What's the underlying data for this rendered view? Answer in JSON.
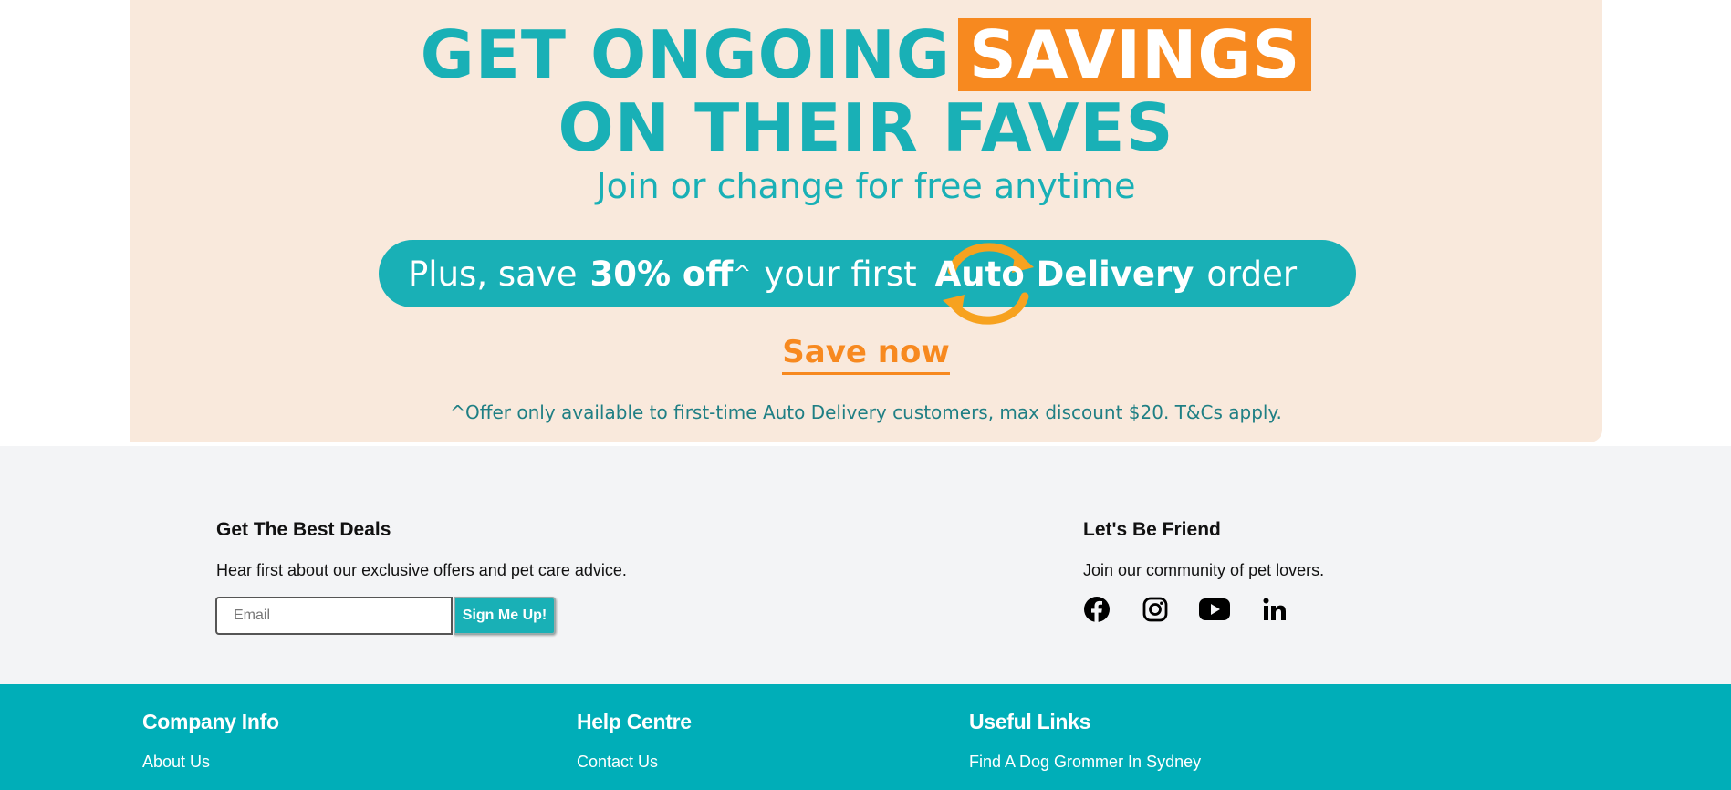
{
  "banner": {
    "headline_part1": "GET ONGOING",
    "headline_highlight": "SAVINGS",
    "headline_line2": "ON THEIR FAVES",
    "subheadline": "Join or change for free anytime",
    "pill": {
      "prefix": "Plus, save",
      "discount": "30% off",
      "caret": "^",
      "middle": "your first",
      "program": "Auto Delivery",
      "suffix": "order"
    },
    "cta": "Save now",
    "disclaimer": "^Offer only available to first-time Auto Delivery customers, max discount $20. T&Cs apply.",
    "colors": {
      "background": "#f9e9dc",
      "teal": "#19b0b6",
      "orange": "#f7891f"
    }
  },
  "newsletter": {
    "heading": "Get The Best Deals",
    "description": "Hear first about our exclusive offers and pet care advice.",
    "email_placeholder": "Email",
    "email_value": "",
    "button_label": "Sign Me Up!"
  },
  "social": {
    "heading": "Let's Be Friend",
    "description": "Join our community of pet lovers.",
    "icons": [
      "facebook-icon",
      "instagram-icon",
      "youtube-icon",
      "linkedin-icon"
    ]
  },
  "footer": {
    "background": "#00aeb8",
    "columns": [
      {
        "heading": "Company Info",
        "first_link": "About Us"
      },
      {
        "heading": "Help Centre",
        "first_link": "Contact Us"
      },
      {
        "heading": "Useful Links",
        "first_link": "Find A Dog Grommer In Sydney"
      }
    ]
  }
}
